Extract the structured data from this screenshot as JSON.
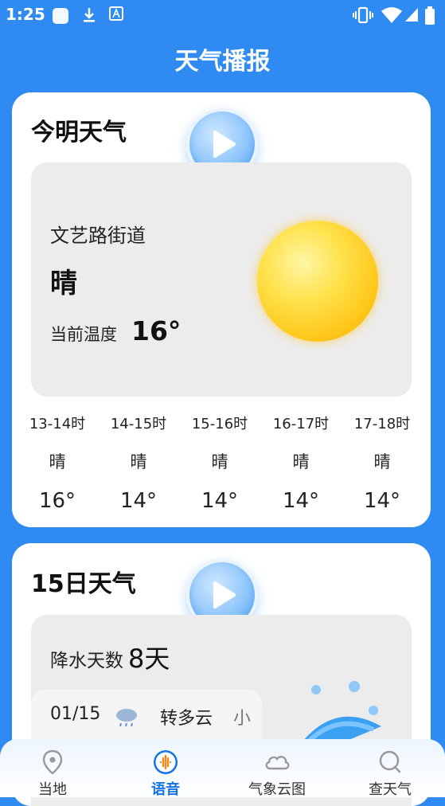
{
  "status_bar": {
    "time": "1:25"
  },
  "header": {
    "title": "天气播报"
  },
  "today_card": {
    "title": "今明天气",
    "location": "文艺路街道",
    "condition": "晴",
    "temp_label": "当前温度",
    "temp_value": "16°",
    "hourly": [
      {
        "time": "13-14时",
        "cond": "晴",
        "temp": "16°"
      },
      {
        "time": "14-15时",
        "cond": "晴",
        "temp": "14°"
      },
      {
        "time": "15-16时",
        "cond": "晴",
        "temp": "14°"
      },
      {
        "time": "16-17时",
        "cond": "晴",
        "temp": "14°"
      },
      {
        "time": "17-18时",
        "cond": "晴",
        "temp": "14°"
      }
    ]
  },
  "forecast_card": {
    "title": "15日天气",
    "rain_label": "降水天数",
    "rain_value": "8天",
    "days": [
      {
        "date": "01/15",
        "cond": "转多云",
        "extra": "小"
      }
    ]
  },
  "nav": {
    "items": [
      {
        "label": "当地",
        "icon": "location-pin-icon"
      },
      {
        "label": "语音",
        "icon": "voice-icon"
      },
      {
        "label": "气象云图",
        "icon": "cloud-icon"
      },
      {
        "label": "查天气",
        "icon": "search-icon"
      }
    ],
    "active": "语音"
  },
  "colors": {
    "background": "#2f8bf2",
    "accent": "#1473e6",
    "card": "#ffffff",
    "panel": "#ececec"
  }
}
